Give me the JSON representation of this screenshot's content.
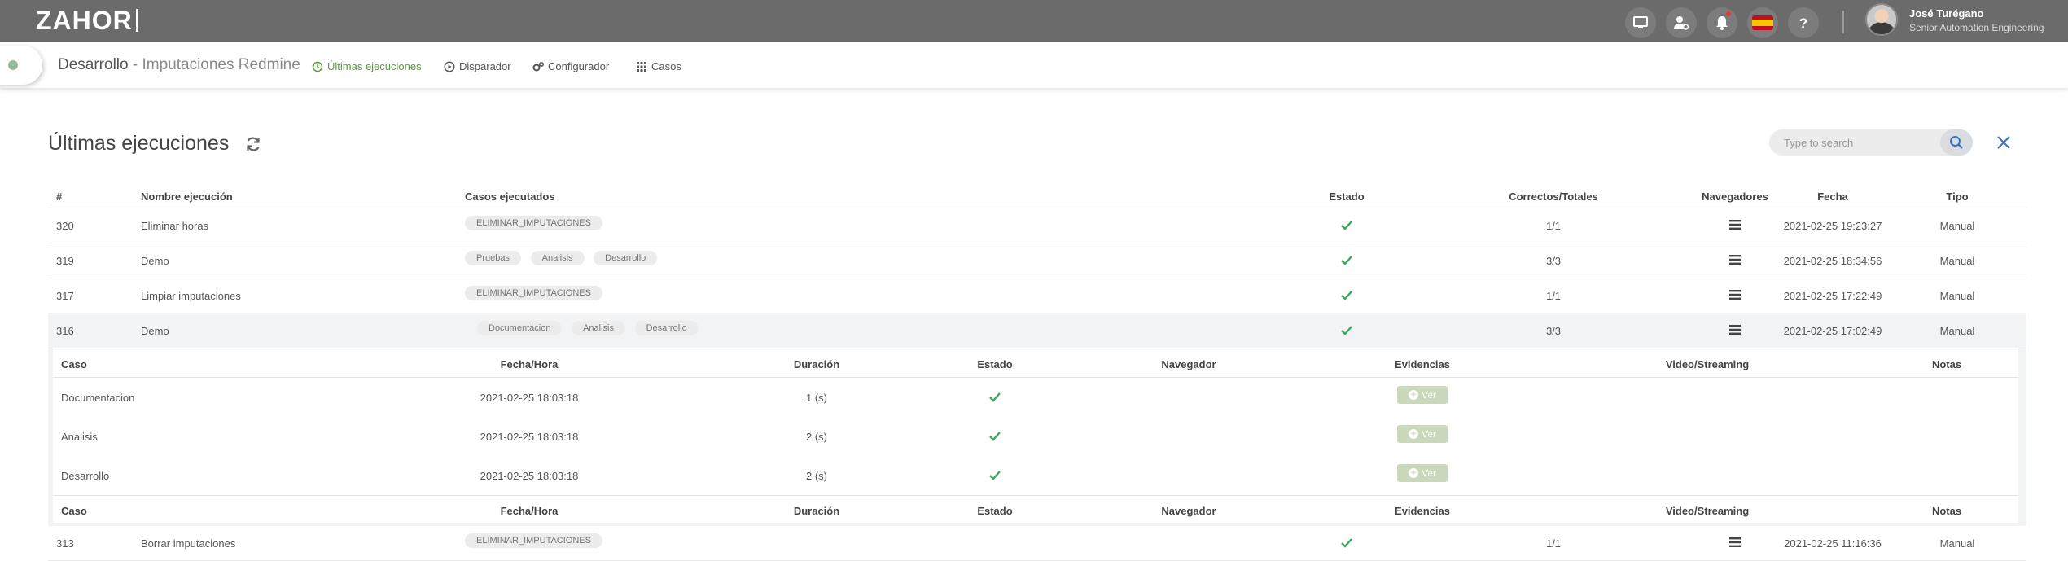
{
  "header": {
    "logo_text": "ZAHOR",
    "user_name": "José Turégano",
    "user_role": "Senior Automation Engineering",
    "icons": [
      "monitor-icon",
      "user-settings-icon",
      "bell-icon",
      "spain-flag-icon",
      "help-icon"
    ]
  },
  "subnav": {
    "project": "Desarrollo",
    "project_sub": " - Imputaciones Redmine",
    "items": [
      {
        "label": "Últimas ejecuciones",
        "icon": "history-icon",
        "active": true
      },
      {
        "label": "Disparador",
        "icon": "play-circle-icon",
        "active": false
      },
      {
        "label": "Configurador",
        "icon": "gears-icon",
        "active": false
      },
      {
        "label": "Casos",
        "icon": "grid-icon",
        "active": false
      }
    ]
  },
  "page": {
    "title": "Últimas ejecuciones",
    "search_placeholder": "Type to search"
  },
  "table": {
    "headers": [
      "#",
      "Nombre ejecución",
      "Casos ejecutados",
      "Estado",
      "Correctos/Totales",
      "Navegadores",
      "Fecha",
      "Tipo"
    ],
    "rows": [
      {
        "id": "320",
        "name": "Eliminar horas",
        "cases": [
          "ELIMINAR_IMPUTACIONES"
        ],
        "ratio": "1/1",
        "date": "2021-02-25 19:23:27",
        "type": "Manual"
      },
      {
        "id": "319",
        "name": "Demo",
        "cases": [
          "Pruebas",
          "Analisis",
          "Desarrollo"
        ],
        "ratio": "3/3",
        "date": "2021-02-25 18:34:56",
        "type": "Manual"
      },
      {
        "id": "317",
        "name": "Limpiar imputaciones",
        "cases": [
          "ELIMINAR_IMPUTACIONES"
        ],
        "ratio": "1/1",
        "date": "2021-02-25 17:22:49",
        "type": "Manual"
      },
      {
        "id": "316",
        "name": "Demo",
        "cases": [
          "Documentacion",
          "Analisis",
          "Desarrollo"
        ],
        "ratio": "3/3",
        "date": "2021-02-25 17:02:49",
        "type": "Manual"
      },
      {
        "id": "313",
        "name": "Borrar imputaciones",
        "cases": [
          "ELIMINAR_IMPUTACIONES"
        ],
        "ratio": "1/1",
        "date": "2021-02-25 11:16:36",
        "type": "Manual"
      }
    ]
  },
  "detail": {
    "headers": [
      "Caso",
      "Fecha/Hora",
      "Duración",
      "Estado",
      "Navegador",
      "Evidencias",
      "Video/Streaming",
      "Notas"
    ],
    "button_label": "Ver",
    "rows": [
      {
        "case": "Documentacion",
        "datetime": "2021-02-25 18:03:18",
        "duration": "1 (s)"
      },
      {
        "case": "Analisis",
        "datetime": "2021-02-25 18:03:18",
        "duration": "2 (s)"
      },
      {
        "case": "Desarrollo",
        "datetime": "2021-02-25 18:03:18",
        "duration": "2 (s)"
      }
    ]
  },
  "colors": {
    "header_bg": "#6b6b6b",
    "accent_green": "#5a9a3c",
    "check_green": "#3aa85a",
    "row_expanded_bg": "#f1f3f5"
  }
}
